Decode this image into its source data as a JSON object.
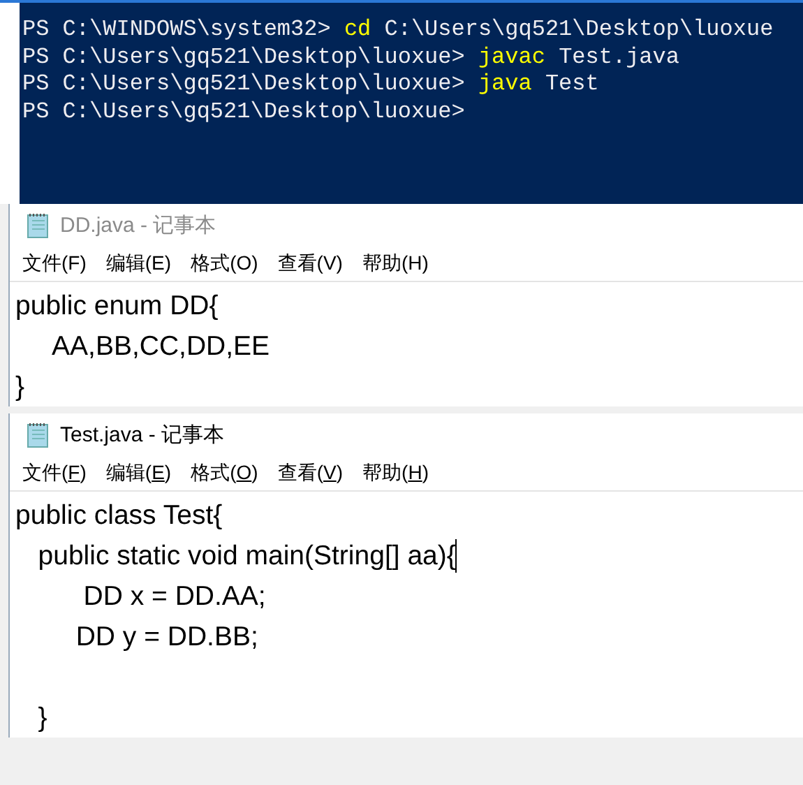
{
  "terminal": {
    "lines": [
      {
        "prompt": "PS C:\\WINDOWS\\system32>",
        "command": "cd",
        "args": "C:\\Users\\gq521\\Desktop\\luoxue"
      },
      {
        "prompt": "PS C:\\Users\\gq521\\Desktop\\luoxue>",
        "command": "javac",
        "args": "Test.java"
      },
      {
        "prompt": "PS C:\\Users\\gq521\\Desktop\\luoxue>",
        "command": "java",
        "args": "Test"
      },
      {
        "prompt": "PS C:\\Users\\gq521\\Desktop\\luoxue>"
      }
    ]
  },
  "notepads": [
    {
      "title": "DD.java - 记事本",
      "active": false,
      "accelerators_underlined": false,
      "menu": [
        "文件(F)",
        "编辑(E)",
        "格式(O)",
        "查看(V)",
        "帮助(H)"
      ],
      "lines": [
        {
          "text": "public enum DD{",
          "cursor": false
        },
        {
          "text": "     AA,BB,CC,DD,EE",
          "cursor": false
        },
        {
          "text": "}",
          "cursor": false
        }
      ]
    },
    {
      "title": "Test.java - 记事本",
      "active": true,
      "accelerators_underlined": true,
      "menu": [
        "文件(F)",
        "编辑(E)",
        "格式(O)",
        "查看(V)",
        "帮助(H)"
      ],
      "lines": [
        {
          "text": "public class Test{",
          "cursor": false
        },
        {
          "text": "   public static void main(String[] aa){",
          "cursor": true
        },
        {
          "text": "         DD x = DD.AA;",
          "cursor": false
        },
        {
          "text": "        DD y = DD.BB;",
          "cursor": false
        },
        {
          "kind": "blank"
        },
        {
          "text": "   }",
          "cursor": false
        }
      ]
    }
  ]
}
